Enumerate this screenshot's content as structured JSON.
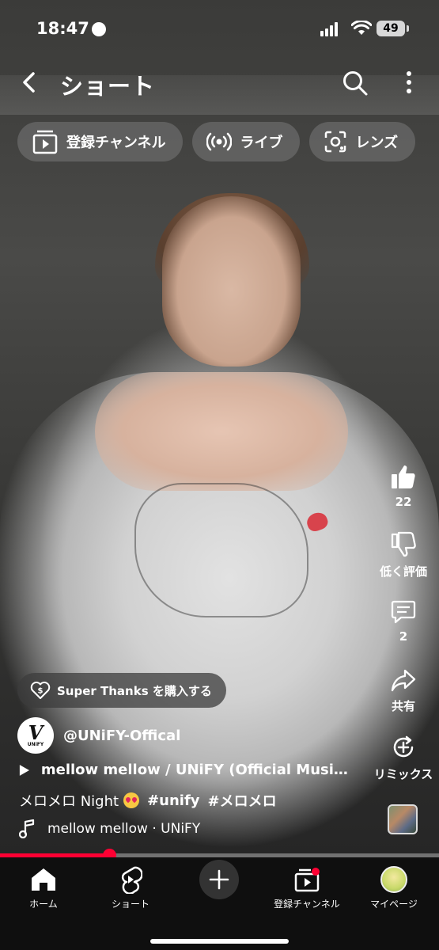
{
  "status_bar": {
    "time": "18:47",
    "battery": "49"
  },
  "header": {
    "title": "ショート"
  },
  "chips": [
    {
      "label": "登録チャンネル",
      "icon": "subscriptions-icon"
    },
    {
      "label": "ライブ",
      "icon": "live-icon"
    },
    {
      "label": "レンズ",
      "icon": "lens-icon"
    }
  ],
  "actions": {
    "like_count": "22",
    "dislike_label": "低く評価",
    "comment_count": "2",
    "share_label": "共有",
    "remix_label": "リミックス"
  },
  "super_thanks": {
    "label": "Super Thanks を購入する"
  },
  "channel": {
    "handle": "@UNiFY-Offical",
    "avatar_letter": "V",
    "avatar_sub": "UNiFY"
  },
  "related_video": {
    "title": "mellow mellow / UNiFY (Official Music Video)"
  },
  "caption": {
    "text": "メロメロ Night",
    "hashtags": [
      "#unify",
      "#メロメロ"
    ]
  },
  "music": {
    "label": "mellow mellow · UNiFY"
  },
  "playback": {
    "progress": 0.25
  },
  "bottom_nav": [
    {
      "label": "ホーム",
      "icon": "home-icon"
    },
    {
      "label": "ショート",
      "icon": "shorts-icon"
    },
    {
      "label": "",
      "icon": "create-icon"
    },
    {
      "label": "登録チャンネル",
      "icon": "subscriptions-icon"
    },
    {
      "label": "マイページ",
      "icon": "avatar"
    }
  ],
  "colors": {
    "accent": "#ff0033",
    "chip_bg": "#787878",
    "nav_bg": "#0f0f0f"
  }
}
